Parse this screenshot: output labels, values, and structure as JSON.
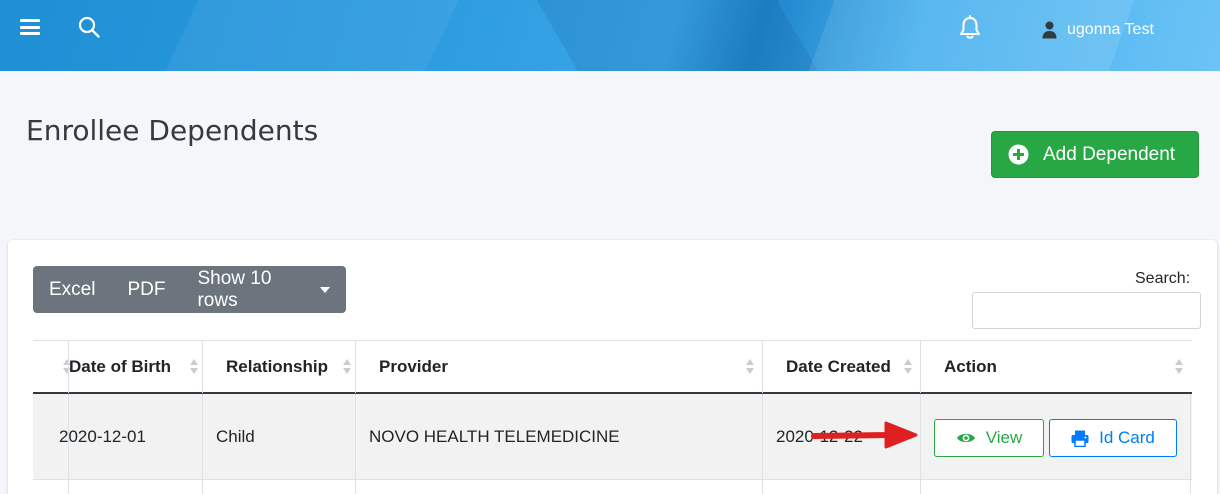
{
  "header": {
    "menu_icon": "hamburger-menu-icon",
    "search_icon": "search-icon",
    "notification_icon": "bell-icon",
    "user_icon": "user-icon",
    "user_name": "ugonna Test"
  },
  "page": {
    "title": "Enrollee Dependents",
    "add_button_label": "Add Dependent",
    "add_button_icon": "plus-circle-icon"
  },
  "table_controls": {
    "buttons": [
      "Excel",
      "PDF",
      "Show 10 rows"
    ],
    "search_label": "Search:",
    "search_value": ""
  },
  "table": {
    "columns": [
      "Date of Birth",
      "Relationship",
      "Provider",
      "Date Created",
      "Action"
    ],
    "rows": [
      {
        "date_of_birth": "2020-12-01",
        "relationship": "Child",
        "provider": "NOVO HEALTH TELEMEDICINE",
        "date_created": "2020-12-22",
        "actions": [
          "View",
          "Id Card"
        ]
      }
    ]
  },
  "colors": {
    "primary_green": "#28a745",
    "primary_blue": "#007bff",
    "annotation_red": "#e02020",
    "topbar_blue": "#2d9be0",
    "button_gray": "#6c757d"
  }
}
